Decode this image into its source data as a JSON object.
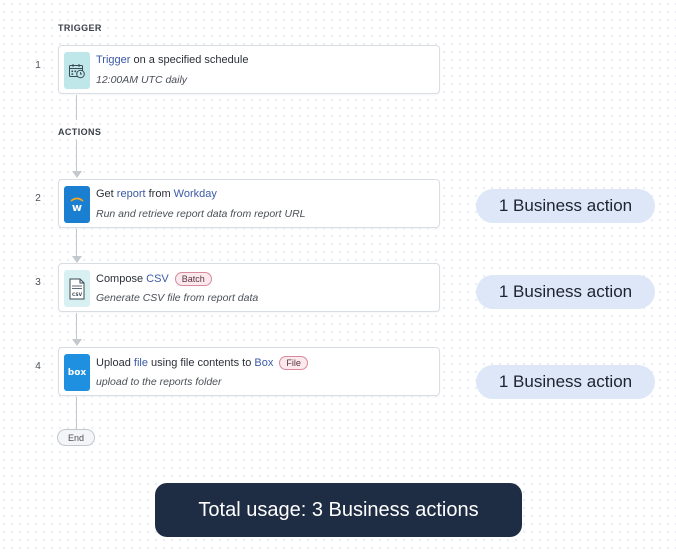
{
  "sections": {
    "trigger_label": "TRIGGER",
    "actions_label": "ACTIONS"
  },
  "steps": [
    {
      "number": "1",
      "icon": "calendar-clock-icon",
      "title_parts": [
        "Trigger",
        " on a specified schedule"
      ],
      "subtitle": "12:00AM UTC daily"
    },
    {
      "number": "2",
      "icon": "workday-logo-icon",
      "icon_letter": "w",
      "title_parts": [
        "Get ",
        "report",
        " from ",
        "Workday"
      ],
      "subtitle": "Run and retrieve report data from report URL"
    },
    {
      "number": "3",
      "icon": "csv-file-icon",
      "icon_letter": "CSV",
      "title_parts": [
        "Compose ",
        "CSV"
      ],
      "badge": "Batch",
      "subtitle": "Generate CSV file from report data"
    },
    {
      "number": "4",
      "icon": "box-logo-icon",
      "icon_letter": "box",
      "title_parts": [
        "Upload ",
        "file",
        " using file contents to ",
        "Box"
      ],
      "badge": "File",
      "subtitle": "upload to the reports folder"
    }
  ],
  "end_label": "End",
  "business_actions": [
    "1 Business action",
    "1 Business action",
    "1 Business action"
  ],
  "total_usage": "Total usage: 3 Business actions",
  "colors": {
    "keyword": "#3b59a6",
    "trigger_icon_bg": "#bfe7ea",
    "workday_icon_bg": "#1b7fd1",
    "csv_icon_bg": "#d8f0f1",
    "box_icon_bg": "#1f8fe0",
    "action_pill_bg": "#dde7f7",
    "total_bg": "#1f2d44"
  }
}
